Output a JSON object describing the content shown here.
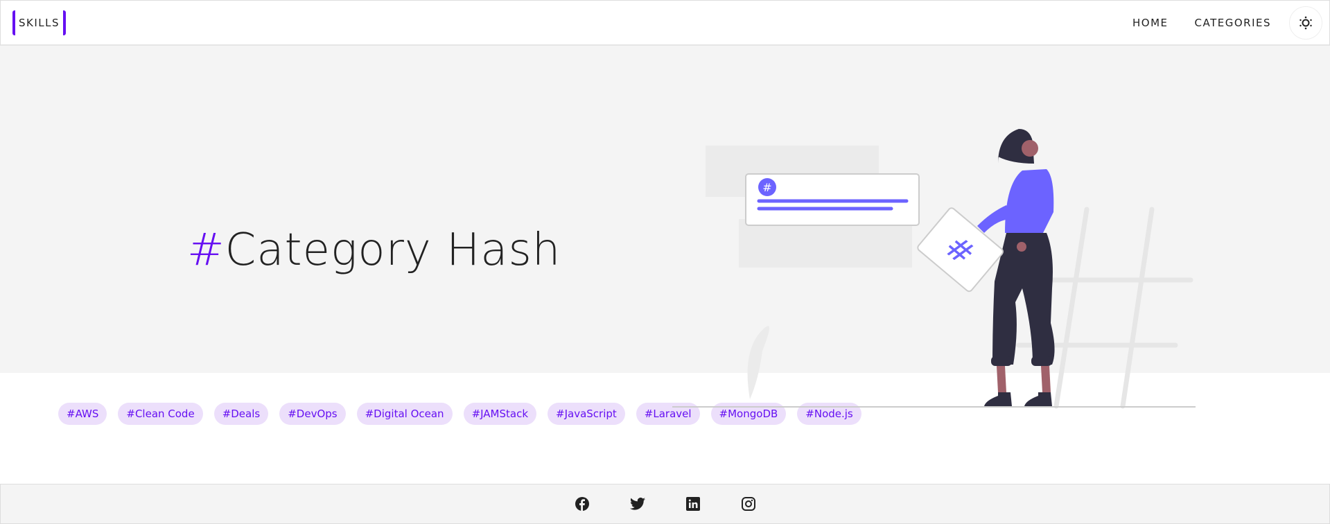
{
  "header": {
    "logo": "SKILLS",
    "nav": [
      {
        "label": "HOME"
      },
      {
        "label": "CATEGORIES"
      }
    ],
    "theme_toggle_icon": "sun-icon"
  },
  "hero": {
    "hash": "#",
    "title": "Category Hash"
  },
  "tags": [
    "#AWS",
    "#Clean Code",
    "#Deals",
    "#DevOps",
    "#Digital Ocean",
    "#JAMStack",
    "#JavaScript",
    "#Laravel",
    "#MongoDB",
    "#Node.js"
  ],
  "footer": {
    "icons": [
      "facebook-icon",
      "twitter-icon",
      "linkedin-icon",
      "instagram-icon"
    ]
  },
  "colors": {
    "accent": "#6610f2",
    "tag_bg": "#ecdffb",
    "illustration": "#6c63ff"
  }
}
